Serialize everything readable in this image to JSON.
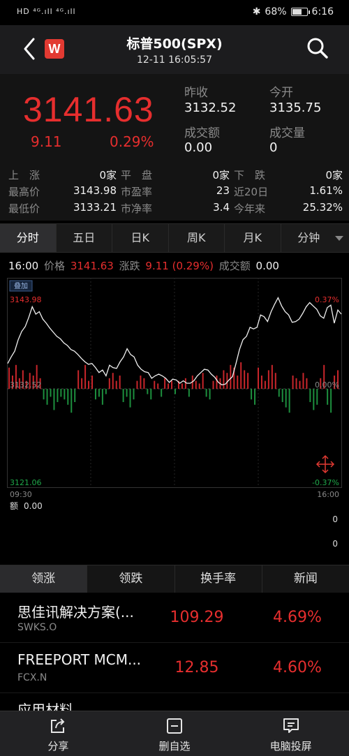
{
  "status_bar": {
    "signal": "HD ⁴ᴳ.ıll ⁴ᴳ.ıll",
    "battery_pct": "68%",
    "battery_level": 0.68,
    "time": "6:16"
  },
  "header": {
    "logo_letter": "W",
    "title": "标普500(SPX)",
    "subtitle": "12-11 16:05:57"
  },
  "quote": {
    "price": "3141.63",
    "change": "9.11",
    "change_pct": "0.29%",
    "prev_close_label": "昨收",
    "prev_close": "3132.52",
    "open_label": "今开",
    "open": "3135.75",
    "turnover_label": "成交额",
    "turnover": "0.00",
    "volume_label": "成交量",
    "volume": "0",
    "stats": [
      {
        "l1": "上　涨",
        "v1": "0家",
        "l2": "平　盘",
        "v2": "0家",
        "l3": "下　跌",
        "v3": "0家"
      },
      {
        "l1": "最高价",
        "v1": "3143.98",
        "l2": "市盈率",
        "v2": "23",
        "l3": "近20日",
        "v3": "1.61%"
      },
      {
        "l1": "最低价",
        "v1": "3133.21",
        "l2": "市净率",
        "v2": "3.4",
        "l3": "今年来",
        "v3": "25.32%"
      }
    ]
  },
  "tabs": [
    "分时",
    "五日",
    "日K",
    "周K",
    "月K",
    "分钟"
  ],
  "infoline": {
    "time": "16:00",
    "price_label": "价格",
    "price": "3141.63",
    "chg_label": "涨跌",
    "chg": "9.11 (0.29%)",
    "turnover_label": "成交额",
    "turnover": "0.00"
  },
  "chart_data": {
    "type": "line",
    "badge": "叠加",
    "y_top_label": "3143.98",
    "y_mid_label": "3132.52",
    "y_bottom_label": "3121.06",
    "pct_top_label": "0.37%",
    "pct_mid_label": "0.00%",
    "pct_bottom_label": "-0.37%",
    "x_start_label": "09:30",
    "x_end_label": "16:00",
    "ylim": [
      3121.06,
      3143.98
    ],
    "prev_close": 3132.52,
    "series": [
      {
        "values": [
          3135.6,
          3136.4,
          3137.1,
          3138.5,
          3139.5,
          3140.1,
          3141.2,
          3142.5,
          3141.6,
          3141.9,
          3141.0,
          3140.5,
          3139.9,
          3139.4,
          3138.9,
          3138.6,
          3138.1,
          3137.8,
          3137.3,
          3137.1,
          3136.7,
          3136.2,
          3135.8,
          3135.5,
          3135.6,
          3135.1,
          3134.5,
          3134.8,
          3134.1,
          3135.4,
          3135.1,
          3135.0,
          3135.8,
          3136.4,
          3137.4,
          3136.7,
          3136.4,
          3135.4,
          3134.9,
          3134.6,
          3134.5,
          3133.8,
          3134.1,
          3134.3,
          3134.1,
          3133.8,
          3133.3,
          3133.7,
          3133.6,
          3133.2,
          3133.5,
          3133.2,
          3133.2,
          3133.5,
          3134.1,
          3134.5,
          3134.9,
          3134.8,
          3134.3,
          3133.9,
          3133.3,
          3133.0,
          3133.1,
          3133.6,
          3134.0,
          3135.6,
          3137.3,
          3138.5,
          3138.9,
          3140.0,
          3139.8,
          3140.0,
          3141.5,
          3141.3,
          3140.7,
          3141.9,
          3142.8,
          3143.6,
          3142.6,
          3141.9,
          3141.5,
          3140.6,
          3140.7,
          3141.0,
          3141.7,
          3142.5,
          3143.0,
          3142.6,
          3142.2,
          3141.4,
          3141.1,
          3142.4,
          3142.7,
          3140.5,
          3142.1,
          3141.6
        ]
      }
    ],
    "volume_bars": [
      0.8,
      0.5,
      0.9,
      0.4,
      0.7,
      0.3,
      0.6,
      0.5,
      0.9,
      0.4,
      -0.4,
      -0.6,
      -0.3,
      -0.8,
      -0.5,
      -0.3,
      -0.4,
      -0.6,
      -0.9,
      -0.5,
      0.7,
      0.4,
      0.9,
      0.3,
      0.5,
      -0.4,
      -0.3,
      -0.6,
      -0.2,
      0.4,
      0.6,
      0.3,
      0.5,
      -0.5,
      -0.3,
      -0.7,
      -0.4,
      0.3,
      0.5,
      0.4,
      -0.2,
      -0.4,
      0.3,
      0.2,
      -0.3,
      0.4,
      0.2,
      0.3,
      -0.2,
      0.3,
      0.2,
      0.4,
      -0.3,
      0.5,
      0.3,
      0.2,
      0.6,
      -0.3,
      -0.4,
      0.3,
      0.5,
      0.4,
      0.7,
      0.6,
      0.9,
      0.8,
      0.5,
      1.0,
      0.7,
      0.6,
      -0.4,
      -0.6,
      0.8,
      0.5,
      0.3,
      0.7,
      0.9,
      0.6,
      -0.3,
      -0.5,
      -0.7,
      -0.9,
      0.5,
      0.4,
      0.3,
      0.6,
      0.4,
      -0.5,
      -0.8,
      -0.6,
      0.4,
      0.9,
      -0.6,
      -0.9,
      0.5,
      0.7
    ]
  },
  "bottom_tabs": [
    "领涨",
    "领跌",
    "换手率",
    "新闻"
  ],
  "volume_label": "额",
  "volume_value": "0.00",
  "right_zero_1": "0",
  "right_zero_2": "0",
  "stocks": [
    {
      "name": "思佳讯解决方案(...",
      "code": "SWKS.O",
      "price": "109.29",
      "pct": "4.69%"
    },
    {
      "name": "FREEPORT MCM...",
      "code": "FCX.N",
      "price": "12.85",
      "pct": "4.60%"
    },
    {
      "name": "应用材料",
      "code": "",
      "price": "",
      "pct": ""
    }
  ],
  "bottom_bar": [
    "分享",
    "删自选",
    "电脑投屏"
  ]
}
